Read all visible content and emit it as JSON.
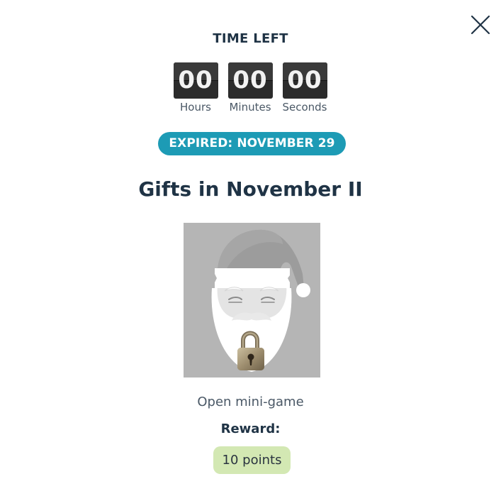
{
  "header": {
    "close_icon": "close-icon",
    "time_left_label": "TIME LEFT"
  },
  "timer": {
    "hours": "00",
    "minutes": "00",
    "seconds": "00",
    "hours_label": "Hours",
    "minutes_label": "Minutes",
    "seconds_label": "Seconds"
  },
  "status": {
    "expired_text": "EXPIRED: NOVEMBER 29",
    "badge_color": "#1d9bb5"
  },
  "event": {
    "title": "Gifts in November II",
    "image_icon": "santa-locked-icon",
    "open_link": "Open mini-game",
    "reward_label": "Reward:",
    "reward_value": "10 points",
    "reward_color": "#d3e8b3"
  }
}
